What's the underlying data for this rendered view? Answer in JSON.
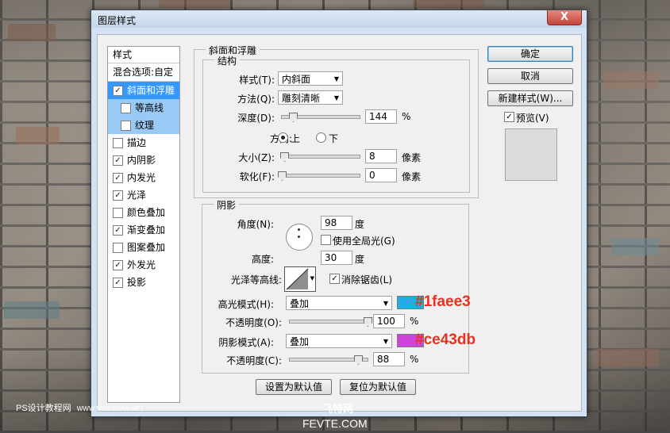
{
  "dialog": {
    "title": "图层样式",
    "close_label": "X"
  },
  "styles_panel": {
    "header": "样式",
    "blend_options": "混合选项:自定",
    "items": [
      {
        "label": "斜面和浮雕",
        "checked": true,
        "selected": true
      },
      {
        "label": "等高线",
        "checked": false,
        "sub": true
      },
      {
        "label": "纹理",
        "checked": false,
        "sub": true
      },
      {
        "label": "描边",
        "checked": false
      },
      {
        "label": "内阴影",
        "checked": true
      },
      {
        "label": "内发光",
        "checked": true
      },
      {
        "label": "光泽",
        "checked": true
      },
      {
        "label": "颜色叠加",
        "checked": false
      },
      {
        "label": "渐变叠加",
        "checked": true
      },
      {
        "label": "图案叠加",
        "checked": false
      },
      {
        "label": "外发光",
        "checked": true
      },
      {
        "label": "投影",
        "checked": true
      }
    ],
    "check_mark": "✓"
  },
  "bevel": {
    "section_title": "斜面和浮雕",
    "structure_title": "结构",
    "style_label": "样式(T):",
    "style_value": "内斜面",
    "technique_label": "方法(Q):",
    "technique_value": "雕刻清晰",
    "depth_label": "深度(D):",
    "depth_value": "144",
    "depth_level": 0.144,
    "depth_unit": "%",
    "direction_label": "方向:",
    "direction_up": "上",
    "direction_down": "下",
    "size_label": "大小(Z):",
    "size_value": "8",
    "size_level": 0.032,
    "size_unit": "像素",
    "soften_label": "软化(F):",
    "soften_value": "0",
    "soften_unit": "像素"
  },
  "shading": {
    "section_title": "阴影",
    "angle_label": "角度(N):",
    "angle_value": "98",
    "angle_unit": "度",
    "global_light_label": "使用全局光(G)",
    "altitude_label": "高度:",
    "altitude_value": "30",
    "altitude_unit": "度",
    "gloss_contour_label": "光泽等高线:",
    "anti_alias_label": "消除锯齿(L)",
    "highlight_mode_label": "高光模式(H):",
    "highlight_mode_value": "叠加",
    "highlight_color": "#1faee3",
    "highlight_opacity_label": "不透明度(O):",
    "highlight_opacity_value": "100",
    "highlight_opacity_unit": "%",
    "shadow_mode_label": "阴影模式(A):",
    "shadow_mode_value": "叠加",
    "shadow_color": "#ce43db",
    "shadow_opacity_label": "不透明度(C):",
    "shadow_opacity_value": "88",
    "shadow_opacity_unit": "%"
  },
  "annotations": {
    "highlight_hex": "#1faee3",
    "shadow_hex": "#ce43db"
  },
  "defaults": {
    "set_default": "设置为默认值",
    "reset_default": "复位为默认值"
  },
  "buttons": {
    "ok": "确定",
    "cancel": "取消",
    "new_style": "新建样式(W)...",
    "preview": "预览(V)"
  },
  "watermarks": {
    "left": "PS设计教程网",
    "left_url": "WWW.MISSYUAN.NET",
    "center": "飞特网",
    "bottom": "FEVTE.COM"
  }
}
